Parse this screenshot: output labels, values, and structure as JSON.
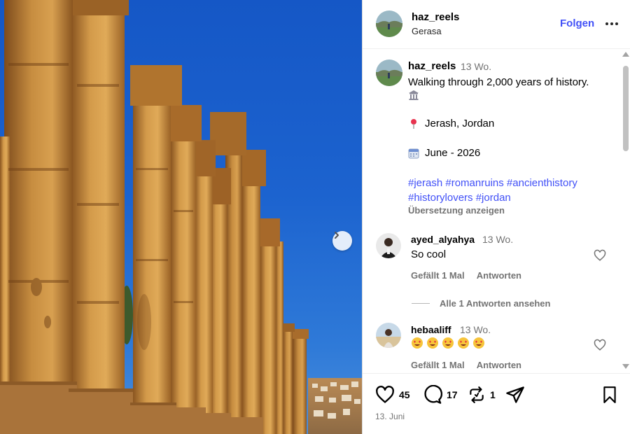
{
  "post": {
    "username": "haz_reels",
    "location": "Gerasa",
    "follow_label": "Folgen",
    "more_icon": "more-options-icon"
  },
  "caption": {
    "username": "haz_reels",
    "time": "13 Wo.",
    "text": "Walking through 2,000 years of history.",
    "location_line": "Jerash, Jordan",
    "date_line": "June - 2026",
    "hashtags": [
      "#jerash",
      "#romanruins",
      "#ancienthistory",
      "#historylovers",
      "#jordan"
    ],
    "translate_label": "Übersetzung anzeigen"
  },
  "comments": [
    {
      "username": "ayed_alyahya",
      "time": "13 Wo.",
      "text": "So cool",
      "likes_label": "Gefällt 1 Mal",
      "reply_label": "Antworten"
    },
    {
      "username": "hebaaliff",
      "time": "13 Wo.",
      "text": "",
      "likes_label": "Gefällt 1 Mal",
      "reply_label": "Antworten"
    }
  ],
  "view_replies_label": "Alle 1 Antworten ansehen",
  "actions": {
    "likes": "45",
    "comments": "17",
    "reposts": "1"
  },
  "post_date": "13. Juni",
  "colors": {
    "link_blue": "#4150f7",
    "muted": "#737373",
    "sky": "#1c63cf",
    "stone": "#c98a3c"
  }
}
